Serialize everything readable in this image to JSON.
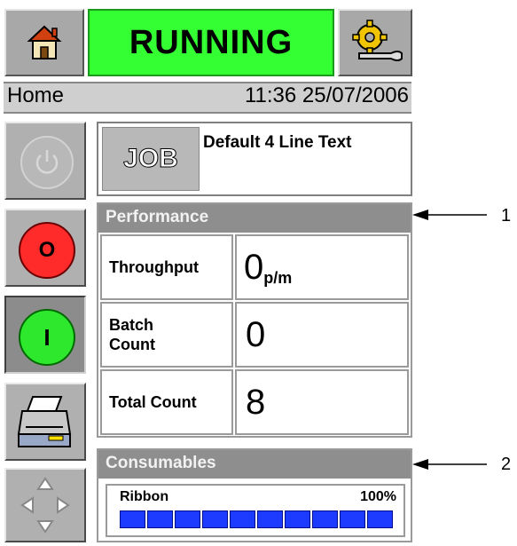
{
  "header": {
    "home_icon": "home-icon",
    "status": "RUNNING",
    "settings_icon": "settings-gear-wrench-icon",
    "status_color": "#33ff33"
  },
  "breadcrumb": "Home",
  "clock": "11:36 25/07/2006",
  "sidebar": {
    "power_icon": "power-icon",
    "stop_label": "O",
    "start_label": "I",
    "printer_icon": "printer-icon",
    "nav_icon": "navigation-arrows-icon"
  },
  "job": {
    "label": "JOB",
    "name": "Default 4 Line Text"
  },
  "performance": {
    "title": "Performance",
    "rows": [
      {
        "label": "Throughput",
        "value": "0",
        "unit": "p/m"
      },
      {
        "label": "Batch Count",
        "value": "0",
        "unit": ""
      },
      {
        "label": "Total Count",
        "value": "8",
        "unit": ""
      }
    ]
  },
  "consumables": {
    "title": "Consumables",
    "ribbon_label": "Ribbon",
    "ribbon_percent": "100%",
    "ribbon_level": 1.0,
    "bar_color": "#1d3bff"
  },
  "callouts": [
    "1",
    "2"
  ]
}
